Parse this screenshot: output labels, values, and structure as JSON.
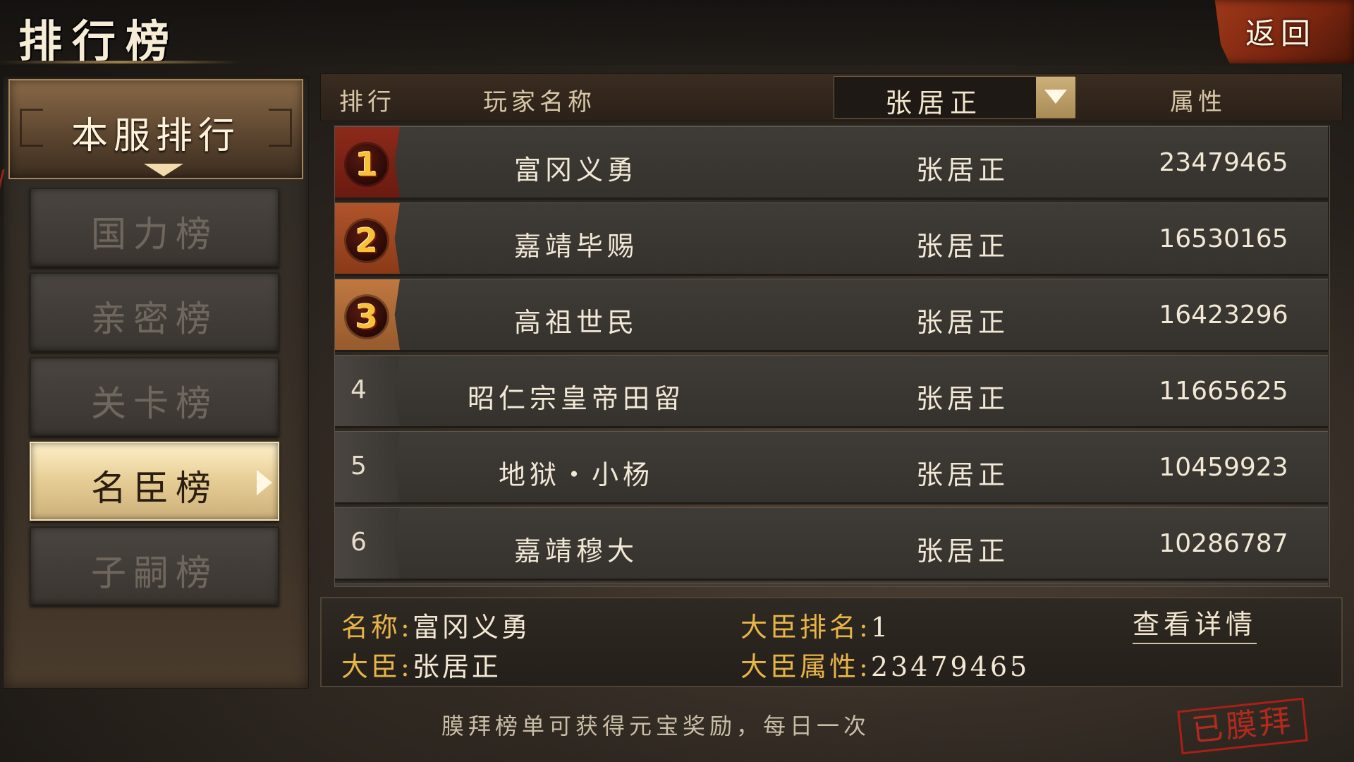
{
  "header": {
    "title": "排行榜",
    "back_label": "返回"
  },
  "sidebar": {
    "server_tab": "本服排行",
    "items": [
      {
        "label": "国力榜",
        "active": false
      },
      {
        "label": "亲密榜",
        "active": false
      },
      {
        "label": "关卡榜",
        "active": false
      },
      {
        "label": "名臣榜",
        "active": true
      },
      {
        "label": "子嗣榜",
        "active": false
      }
    ]
  },
  "table": {
    "col_rank": "排行",
    "col_player": "玩家名称",
    "filter_value": "张居正",
    "col_attr": "属性",
    "rows": [
      {
        "rank": "1",
        "name": "富冈义勇",
        "minister": "张居正",
        "attr": "23479465"
      },
      {
        "rank": "2",
        "name": "嘉靖毕赐",
        "minister": "张居正",
        "attr": "16530165"
      },
      {
        "rank": "3",
        "name": "高祖世民",
        "minister": "张居正",
        "attr": "16423296"
      },
      {
        "rank": "4",
        "name": "昭仁宗皇帝田留",
        "minister": "张居正",
        "attr": "11665625"
      },
      {
        "rank": "5",
        "name": "地狱・小杨",
        "minister": "张居正",
        "attr": "10459923"
      },
      {
        "rank": "6",
        "name": "嘉靖穆大",
        "minister": "张居正",
        "attr": "10286787"
      }
    ]
  },
  "detail": {
    "name_key": "名称:",
    "name_val": "富冈义勇",
    "rank_key": "大臣排名:",
    "rank_val": "1",
    "minister_key": "大臣:",
    "minister_val": "张居正",
    "attr_key": "大臣属性:",
    "attr_val": "23479465",
    "link_label": "查看详情"
  },
  "footer": {
    "note": "膜拜榜单可获得元宝奖励，每日一次",
    "stamp": "已膜拜"
  },
  "colors": {
    "gold_key": "#e7b448",
    "active_tab": "#e5cc94",
    "stamp_red": "#b81e16"
  }
}
